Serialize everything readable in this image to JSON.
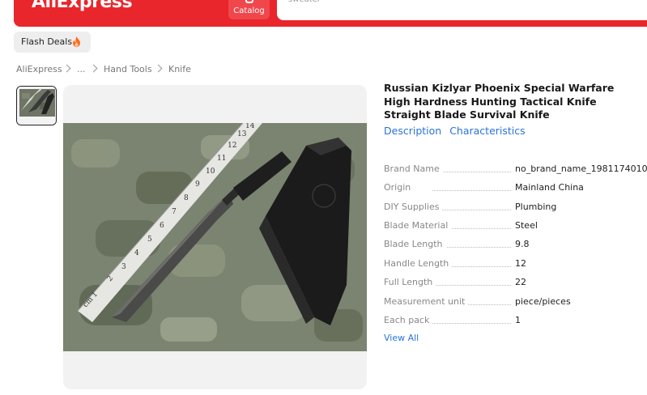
{
  "header": {
    "logo_text": "AliExpress",
    "catalog_label": "Catalog",
    "search_placeholder": "sweater",
    "brand_color": "#e8262c"
  },
  "flash_deals": {
    "label": "Flash Deals",
    "icon": "fire-icon"
  },
  "breadcrumb": [
    "AliExpress",
    "...",
    "Hand Tools",
    "Knife"
  ],
  "product": {
    "title": "Russian Kizlyar Phoenix Special Warfare High Hardness Hunting Tactical Knife Straight Blade Survival Knife",
    "tabs": [
      "Description",
      "Characteristics"
    ],
    "specs": [
      {
        "key": "Brand Name",
        "value": "no_brand_name_1981174010"
      },
      {
        "key": "Origin",
        "value": "Mainland China"
      },
      {
        "key": "DIY Supplies",
        "value": "Plumbing"
      },
      {
        "key": "Blade Material",
        "value": "Steel"
      },
      {
        "key": "Blade Length",
        "value": "9.8"
      },
      {
        "key": "Handle Length",
        "value": "12"
      },
      {
        "key": "Full Length",
        "value": "22"
      },
      {
        "key": "Measurement unit",
        "value": "piece/pieces"
      },
      {
        "key": "Each pack",
        "value": "1"
      }
    ],
    "view_all_label": "View All",
    "ruler_numbers": [
      "cm 1",
      "2",
      "3",
      "4",
      "5",
      "6",
      "7",
      "8",
      "9",
      "10",
      "11",
      "12",
      "13",
      "14"
    ]
  }
}
